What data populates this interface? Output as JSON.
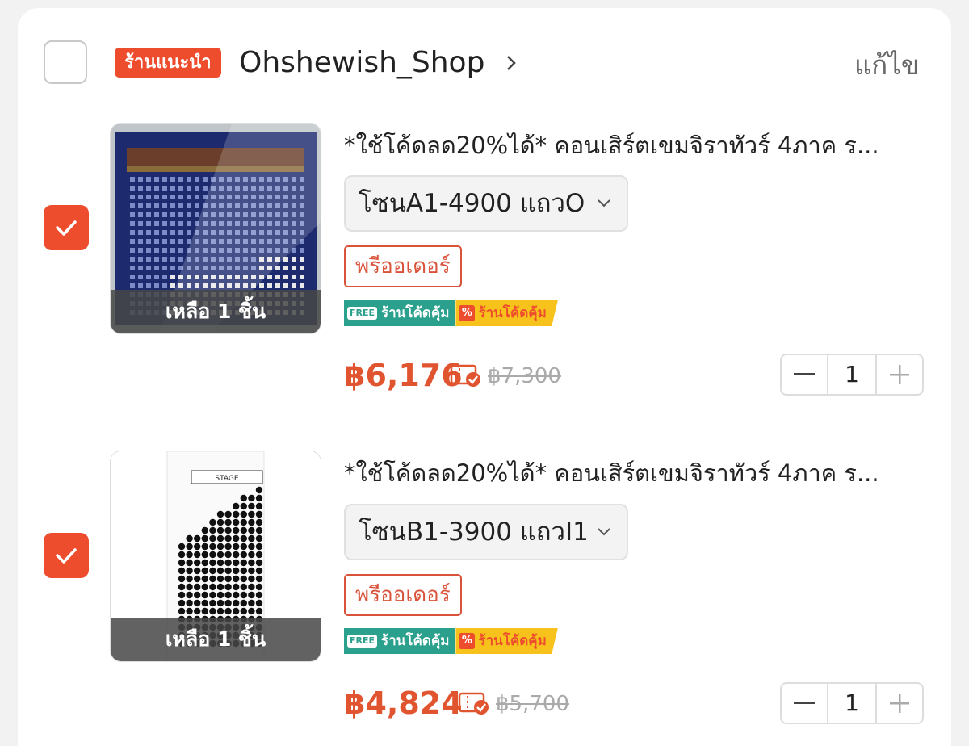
{
  "shop": {
    "badge": "ร้านแนะนำ",
    "name": "Ohshewish_Shop",
    "edit": "แก้ไข"
  },
  "items": [
    {
      "title": "*ใช้โค้ดลด20%ได้* คอนเสิร์ตเขมจิราทัวร์ 4ภาค ร...",
      "variant": "โซนA1-4900 แถวO",
      "stock": "เหลือ 1 ชิ้น",
      "preorder": "พรีออเดอร์",
      "promo_free_tag": "FREE",
      "promo_shipping": "ร้านโค้ดคุ้ม",
      "promo_pct_tag": "%",
      "promo_discount": "ร้านโค้ดคุ้ม",
      "price": "฿6,176",
      "original_price": "฿7,300",
      "quantity": "1",
      "checked": true
    },
    {
      "title": "*ใช้โค้ดลด20%ได้* คอนเสิร์ตเขมจิราทัวร์ 4ภาค ร...",
      "variant": "โซนB1-3900 แถวI1",
      "stock": "เหลือ 1 ชิ้น",
      "preorder": "พรีออเดอร์",
      "promo_free_tag": "FREE",
      "promo_shipping": "ร้านโค้ดคุ้ม",
      "promo_pct_tag": "%",
      "promo_discount": "ร้านโค้ดคุ้ม",
      "price": "฿4,824",
      "original_price": "฿5,700",
      "quantity": "1",
      "checked": true
    }
  ],
  "thumb2_stage": "STAGE",
  "colors": {
    "accent": "#ee4d2d",
    "price": "#e0542f",
    "promo_green": "#2ba08d",
    "promo_yellow": "#f6c21b"
  }
}
